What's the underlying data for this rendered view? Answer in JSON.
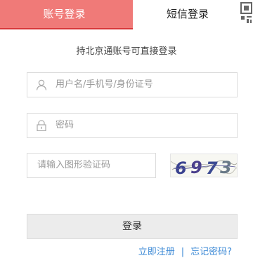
{
  "tabs": {
    "account_login": "账号登录",
    "sms_login": "短信登录"
  },
  "hint": "持北京通账号可直接登录",
  "fields": {
    "username_placeholder": "用户名/手机号/身份证号",
    "password_placeholder": "密码",
    "captcha_placeholder": "请输入图形验证码"
  },
  "captcha": {
    "code": "6973"
  },
  "buttons": {
    "login": "登录"
  },
  "links": {
    "register": "立即注册",
    "separator": "|",
    "forgot_password": "忘记密码?"
  },
  "colors": {
    "active_tab_bg": "#f07a78",
    "active_tab_underline": "#d8383a",
    "link": "#3d8ad6",
    "button_bg": "#ececec"
  },
  "icons": {
    "qr_code": "qr-code-icon",
    "user": "user-icon",
    "lock": "lock-icon"
  }
}
